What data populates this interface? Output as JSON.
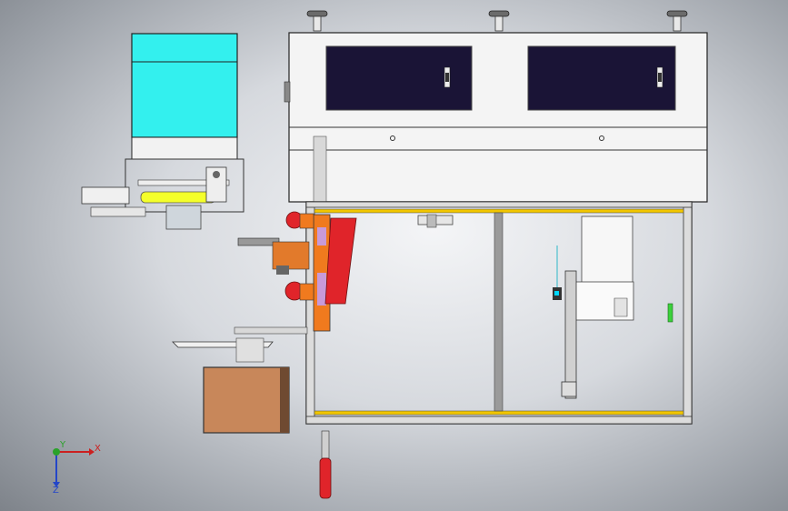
{
  "triad": {
    "x_label": "X",
    "y_label": "Y",
    "z_label": "Z"
  },
  "colors": {
    "hopper": "#33f0ee",
    "frame": "#f2f2f2",
    "window": "#1a1436",
    "rail_yellow": "#f2c600",
    "robot_red": "#e0242a",
    "box": "#c8875a",
    "orange": "#f07a1e"
  },
  "icons": [
    "leveling-foot-icon",
    "window-latch-icon",
    "coordinate-triad-icon"
  ]
}
